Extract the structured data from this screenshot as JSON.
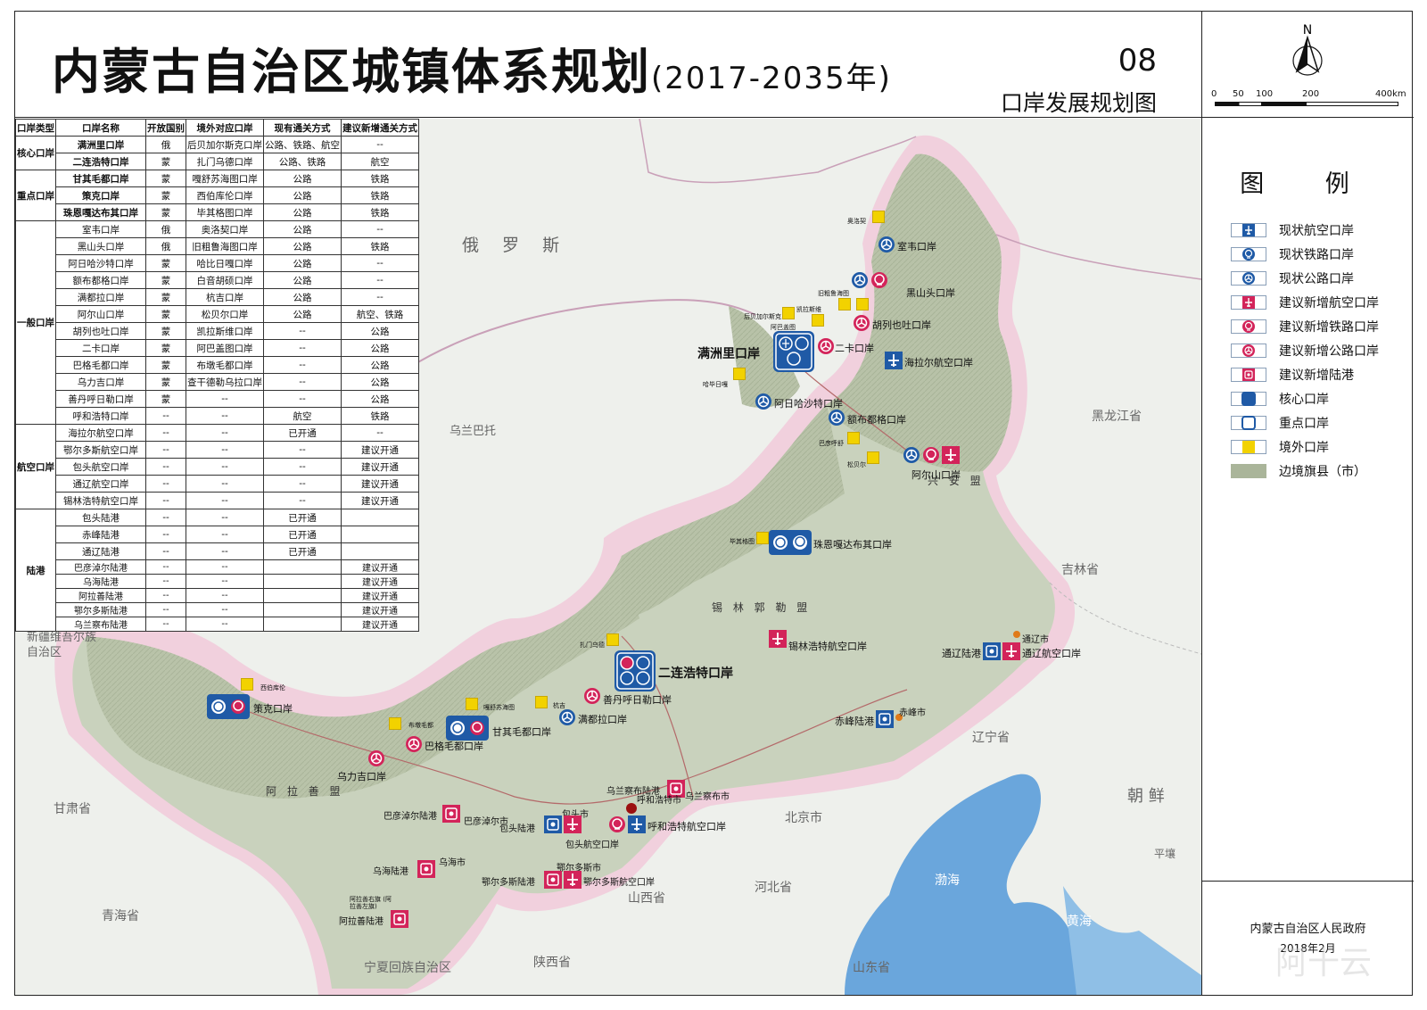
{
  "title": {
    "main": "内蒙古自治区城镇体系规划",
    "years": "(2017-2035年)",
    "map_no": "08",
    "subtitle": "口岸发展规划图"
  },
  "scale": {
    "ticks": [
      "0",
      "50",
      "100",
      "200",
      "400km"
    ]
  },
  "north_label": "N",
  "legend": {
    "title": "图  例",
    "items": [
      {
        "label": "现状航空口岸",
        "icon": "airport-icon",
        "color": "#1f5aa6"
      },
      {
        "label": "现状铁路口岸",
        "icon": "railway-icon",
        "color": "#1f5aa6"
      },
      {
        "label": "现状公路口岸",
        "icon": "road-icon",
        "color": "#1f5aa6"
      },
      {
        "label": "建议新增航空口岸",
        "icon": "airport-icon",
        "color": "#d3245a"
      },
      {
        "label": "建议新增铁路口岸",
        "icon": "railway-icon",
        "color": "#d3245a"
      },
      {
        "label": "建议新增公路口岸",
        "icon": "road-icon",
        "color": "#d3245a"
      },
      {
        "label": "建议新增陆港",
        "icon": "dryport-icon",
        "color": "#d3245a"
      },
      {
        "label": "核心口岸",
        "icon": "core-port-square",
        "color": "#1f5aa6"
      },
      {
        "label": "重点口岸",
        "icon": "key-port-square",
        "color": "#1f5aa6"
      },
      {
        "label": "境外口岸",
        "icon": "foreign-port-square",
        "color": "#f2d200"
      },
      {
        "label": "边境旗县（市）",
        "icon": "border-county-patch",
        "color": "#aab59a"
      }
    ]
  },
  "table": {
    "headers": [
      "口岸类型",
      "口岸名称",
      "开放国别",
      "境外对应口岸",
      "现有通关方式",
      "建议新增通关方式"
    ],
    "groups": [
      {
        "category": "核心口岸",
        "rows": [
          [
            "满洲里口岸",
            "俄",
            "后贝加尔斯克口岸",
            "公路、铁路、航空",
            "--"
          ],
          [
            "二连浩特口岸",
            "蒙",
            "扎门乌德口岸",
            "公路、铁路",
            "航空"
          ]
        ]
      },
      {
        "category": "重点口岸",
        "rows": [
          [
            "甘其毛都口岸",
            "蒙",
            "嘎舒苏海图口岸",
            "公路",
            "铁路"
          ],
          [
            "策克口岸",
            "蒙",
            "西伯库伦口岸",
            "公路",
            "铁路"
          ],
          [
            "珠恩嘎达布其口岸",
            "蒙",
            "毕其格图口岸",
            "公路",
            "铁路"
          ]
        ]
      },
      {
        "category": "一般口岸",
        "rows": [
          [
            "室韦口岸",
            "俄",
            "奥洛契口岸",
            "公路",
            "--"
          ],
          [
            "黑山头口岸",
            "俄",
            "旧粗鲁海图口岸",
            "公路",
            "铁路"
          ],
          [
            "阿日哈沙特口岸",
            "蒙",
            "哈比日嘎口岸",
            "公路",
            "--"
          ],
          [
            "额布都格口岸",
            "蒙",
            "白音胡硕口岸",
            "公路",
            "--"
          ],
          [
            "满都拉口岸",
            "蒙",
            "杭吉口岸",
            "公路",
            "--"
          ],
          [
            "阿尔山口岸",
            "蒙",
            "松贝尔口岸",
            "公路",
            "航空、铁路"
          ],
          [
            "胡列也吐口岸",
            "蒙",
            "凯拉斯维口岸",
            "--",
            "公路"
          ],
          [
            "二卡口岸",
            "蒙",
            "阿巴盖图口岸",
            "--",
            "公路"
          ],
          [
            "巴格毛都口岸",
            "蒙",
            "布墩毛都口岸",
            "--",
            "公路"
          ],
          [
            "乌力吉口岸",
            "蒙",
            "查干德勒乌拉口岸",
            "--",
            "公路"
          ],
          [
            "善丹呼日勒口岸",
            "蒙",
            "--",
            "--",
            "公路"
          ],
          [
            "呼和浩特口岸",
            "--",
            "--",
            "航空",
            "铁路"
          ]
        ]
      },
      {
        "category": "航空口岸",
        "rows": [
          [
            "海拉尔航空口岸",
            "--",
            "--",
            "已开通",
            "--"
          ],
          [
            "鄂尔多斯航空口岸",
            "--",
            "--",
            "--",
            "建议开通"
          ],
          [
            "包头航空口岸",
            "--",
            "--",
            "--",
            "建议开通"
          ],
          [
            "通辽航空口岸",
            "--",
            "--",
            "--",
            "建议开通"
          ],
          [
            "锡林浩特航空口岸",
            "--",
            "--",
            "--",
            "建议开通"
          ]
        ]
      },
      {
        "category": "陆港",
        "rows": [
          [
            "包头陆港",
            "--",
            "--",
            "已开通",
            ""
          ],
          [
            "赤峰陆港",
            "--",
            "--",
            "已开通",
            ""
          ],
          [
            "通辽陆港",
            "--",
            "--",
            "已开通",
            ""
          ],
          [
            "巴彦淖尔陆港",
            "--",
            "--",
            "",
            "建议开通"
          ],
          [
            "乌海陆港",
            "--",
            "--",
            "",
            "建议开通"
          ],
          [
            "阿拉善陆港",
            "--",
            "--",
            "",
            "建议开通"
          ],
          [
            "鄂尔多斯陆港",
            "--",
            "--",
            "",
            "建议开通"
          ],
          [
            "乌兰察布陆港",
            "--",
            "--",
            "",
            "建议开通"
          ]
        ]
      }
    ]
  },
  "map": {
    "regions": [
      "俄 罗 斯",
      "乌兰巴托",
      "黑龙江省",
      "吉林省",
      "辽宁省",
      "朝 鲜",
      "平壤",
      "北京市",
      "河北省",
      "山西省",
      "陕西省",
      "山东省",
      "甘肃省",
      "青海省",
      "宁夏回族自治区",
      "新疆维吾尔族自治区",
      "渤海",
      "黄海"
    ],
    "leagues": [
      "兴 安 盟",
      "锡 林 郭 勒 盟",
      "阿 拉 善 盟"
    ],
    "port_labels": [
      "室韦口岸",
      "黑山头口岸",
      "胡列也吐口岸",
      "二卡口岸",
      "满洲里口岸",
      "海拉尔航空口岸",
      "阿日哈沙特口岸",
      "额布都格口岸",
      "阿尔山口岸",
      "珠恩嘎达布其口岸",
      "锡林浩特航空口岸",
      "通辽陆港",
      "通辽航空口岸",
      "通辽市",
      "二连浩特口岸",
      "善丹呼日勒口岸",
      "满都拉口岸",
      "甘其毛都口岸",
      "巴格毛都口岸",
      "乌力吉口岸",
      "策克口岸",
      "赤峰陆港",
      "赤峰市",
      "乌兰察布陆港",
      "乌兰察布市",
      "呼和浩特市",
      "呼和浩特航空口岸",
      "包头市",
      "包头陆港",
      "包头航空口岸",
      "巴彦淖尔陆港",
      "巴彦淖尔市",
      "乌海陆港",
      "乌海市",
      "鄂尔多斯市",
      "鄂尔多斯陆港",
      "鄂尔多斯航空口岸",
      "阿拉善陆港"
    ],
    "foreign_labels": [
      "奥洛契",
      "旧粗鲁海图",
      "凯拉斯维",
      "后贝加尔斯克",
      "阿巴盖图",
      "哈毕日嘎",
      "巴彦呼舒",
      "松贝尔",
      "毕其格图",
      "扎门乌德",
      "杭吉",
      "嘎舒苏海图",
      "布墩毛都",
      "西伯库伦"
    ],
    "aleague_sub": "阿拉善右旗 (阿拉善左旗)",
    "colors": {
      "border_county": "#9aa98a",
      "inner": "#c9d2bd",
      "pink": "#f2c6d8",
      "blue": "#1f5aa6",
      "red": "#d3245a",
      "yellow": "#f2d200",
      "sea": "#6aa6dc"
    }
  },
  "footer": {
    "publisher": "内蒙古自治区人民政府",
    "date": "2018年2月"
  },
  "watermark": "阿十云"
}
